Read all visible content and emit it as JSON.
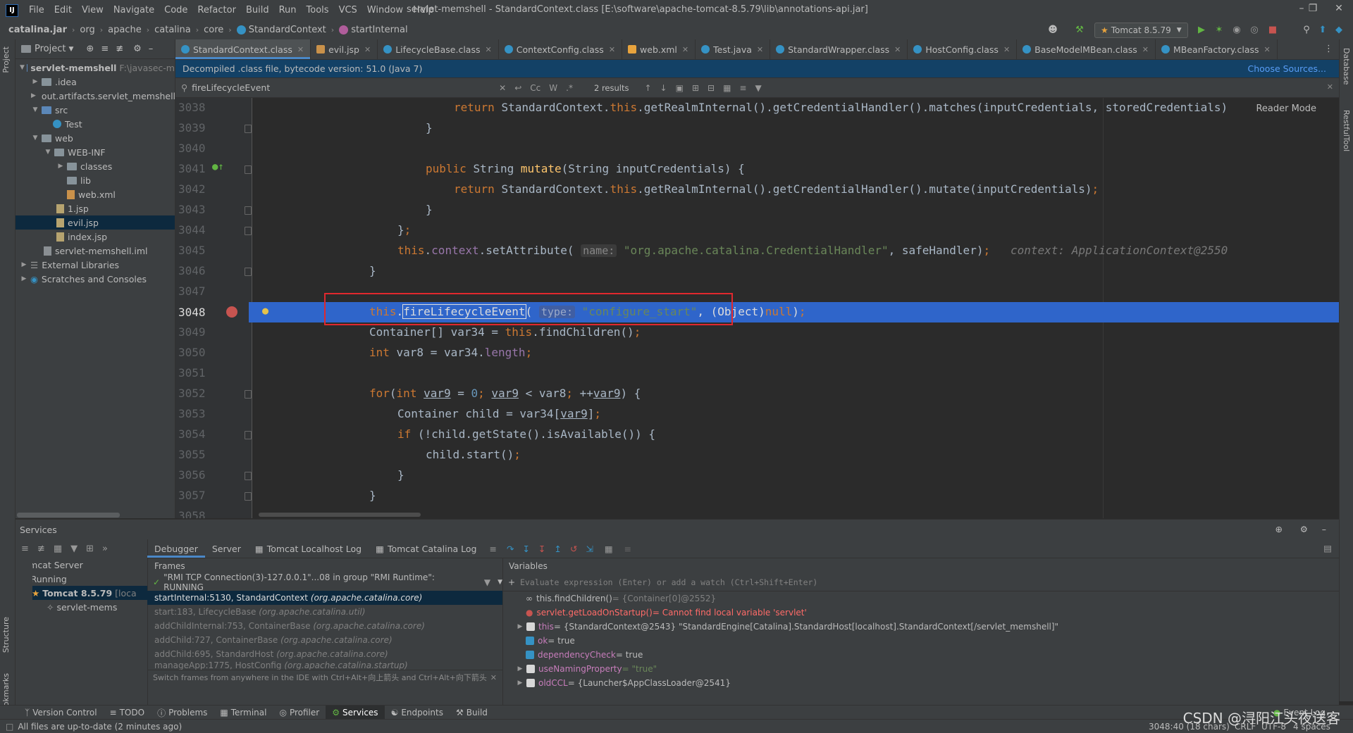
{
  "menubar": {
    "items": [
      "File",
      "Edit",
      "View",
      "Navigate",
      "Code",
      "Refactor",
      "Build",
      "Run",
      "Tools",
      "VCS",
      "Window",
      "Help"
    ],
    "window_title": "servlet-memshell - StandardContext.class [E:\\software\\apache-tomcat-8.5.79\\lib\\annotations-api.jar]"
  },
  "navbar": {
    "crumbs": [
      "catalina.jar",
      "org",
      "apache",
      "catalina",
      "core",
      "StandardContext",
      "startInternal"
    ],
    "run_config": "Tomcat 8.5.79"
  },
  "project": {
    "header": "Project",
    "tree": [
      {
        "label": "servlet-memshell",
        "extra": "F:\\javasec-m"
      },
      {
        "label": ".idea"
      },
      {
        "label": "out.artifacts.servlet_memshell"
      },
      {
        "label": "src"
      },
      {
        "label": "Test"
      },
      {
        "label": "web"
      },
      {
        "label": "WEB-INF"
      },
      {
        "label": "classes"
      },
      {
        "label": "lib"
      },
      {
        "label": "web.xml"
      },
      {
        "label": "1.jsp"
      },
      {
        "label": "evil.jsp"
      },
      {
        "label": "index.jsp"
      },
      {
        "label": "servlet-memshell.iml"
      },
      {
        "label": "External Libraries"
      },
      {
        "label": "Scratches and Consoles"
      }
    ]
  },
  "tabs": [
    "StandardContext.class",
    "evil.jsp",
    "LifecycleBase.class",
    "ContextConfig.class",
    "web.xml",
    "Test.java",
    "StandardWrapper.class",
    "HostConfig.class",
    "BaseModelMBean.class",
    "MBeanFactory.class"
  ],
  "banner": {
    "text": "Decompiled .class file, bytecode version: 51.0 (Java 7)",
    "choose_sources": "Choose Sources..."
  },
  "search": {
    "query": "fireLifecycleEvent",
    "results": "2 results",
    "cc": "Cc",
    "w": "W"
  },
  "editor": {
    "reader_mode": "Reader Mode",
    "line_numbers": [
      "3038",
      "3039",
      "3040",
      "3041",
      "3042",
      "3043",
      "3044",
      "3045",
      "3046",
      "3047",
      "3048",
      "3049",
      "3050",
      "3051",
      "3052",
      "3053",
      "3054",
      "3055",
      "3056",
      "3057",
      "3058"
    ],
    "current_line": "3048"
  },
  "services": {
    "title": "Services",
    "tree": [
      "Tomcat Server",
      "Running",
      "Tomcat 8.5.79",
      "[loca",
      "servlet-mems"
    ],
    "debug_tabs": [
      "Debugger",
      "Server",
      "Tomcat Localhost Log",
      "Tomcat Catalina Log"
    ],
    "frames_label": "Frames",
    "thread": "\"RMI TCP Connection(3)-127.0.0.1\"...08 in group \"RMI Runtime\": RUNNING",
    "frames": [
      {
        "method": "startInternal:5130, StandardContext",
        "pkg": "(org.apache.catalina.core)"
      },
      {
        "method": "start:183, LifecycleBase",
        "pkg": "(org.apache.catalina.util)"
      },
      {
        "method": "addChildInternal:753, ContainerBase",
        "pkg": "(org.apache.catalina.core)"
      },
      {
        "method": "addChild:727, ContainerBase",
        "pkg": "(org.apache.catalina.core)"
      },
      {
        "method": "addChild:695, StandardHost",
        "pkg": "(org.apache.catalina.core)"
      },
      {
        "method": "manageApp:1775, HostConfig",
        "pkg": "(org.apache.catalina.startup)"
      }
    ],
    "frames_hint": "Switch frames from anywhere in the IDE with Ctrl+Alt+向上箭头 and Ctrl+Alt+向下箭头",
    "variables_label": "Variables",
    "eval_placeholder": "Evaluate expression (Enter) or add a watch (Ctrl+Shift+Enter)",
    "variables": [
      {
        "name": "this.findChildren()",
        "value": " = {Container[0]@2552}"
      },
      {
        "name": "servlet.getLoadOnStartup()",
        "value": " = Cannot find local variable 'servlet'"
      },
      {
        "name": "this",
        "value": " = {StandardContext@2543} \"StandardEngine[Catalina].StandardHost[localhost].StandardContext[/servlet_memshell]\""
      },
      {
        "name": "ok",
        "value": " = true"
      },
      {
        "name": "dependencyCheck",
        "value": " = true"
      },
      {
        "name": "useNamingProperty",
        "value": " = \"true\""
      },
      {
        "name": "oldCCL",
        "value": " = {Launcher$AppClassLoader@2541}"
      }
    ]
  },
  "bottombar": {
    "tools": [
      "Version Control",
      "TODO",
      "Problems",
      "Terminal",
      "Profiler",
      "Services",
      "Endpoints",
      "Build"
    ],
    "event_log": "Event Log"
  },
  "statusbar": {
    "message": "All files are up-to-date (2 minutes ago)",
    "position": "3048:40 (18 chars)",
    "line_sep": "CRLF",
    "encoding": "UTF-8",
    "indent": "4 spaces"
  },
  "watermark": "CSDN @浔阳江头夜送客",
  "side_labels": {
    "project": "Project",
    "structure": "Structure",
    "bookmarks": "Bookmarks",
    "database": "Database",
    "restful": "RestfulTool"
  }
}
